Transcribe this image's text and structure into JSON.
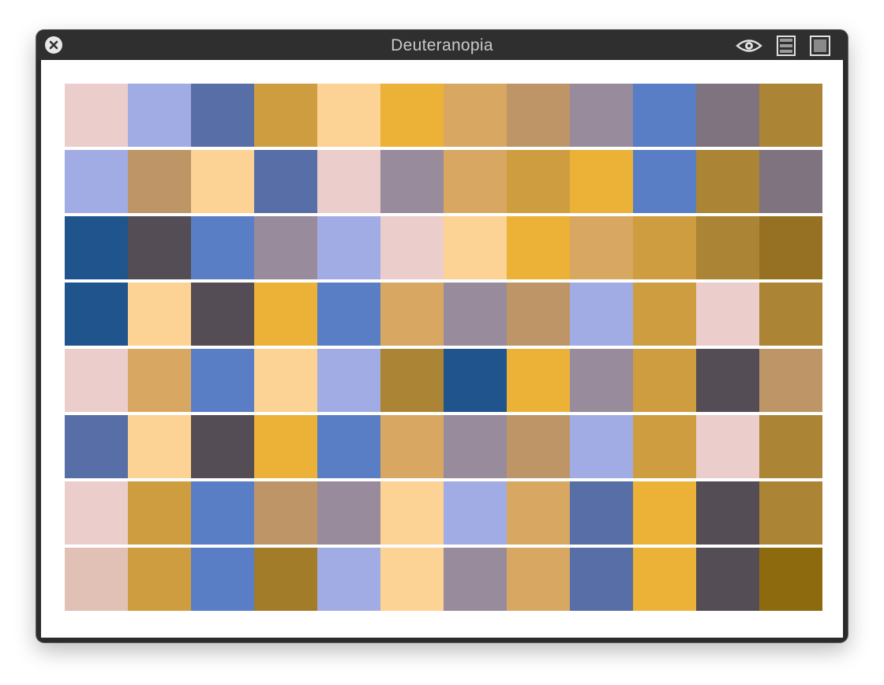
{
  "window": {
    "title": "Deuteranopia",
    "close_icon": "close-icon",
    "toolbar_icons": [
      "eye-icon",
      "list-icon",
      "square-icon"
    ]
  },
  "grid": {
    "rows": [
      [
        "#EBCDCB",
        "#A2ACE4",
        "#586EA6",
        "#CE9D40",
        "#FDD295",
        "#EBB237",
        "#D8A863",
        "#BD9566",
        "#988B9C",
        "#597EC6",
        "#7F737F",
        "#AC8435"
      ],
      [
        "#A2ACE4",
        "#BD9566",
        "#FDD295",
        "#586EA6",
        "#EBCDCB",
        "#988B9C",
        "#D8A863",
        "#CE9D40",
        "#EBB237",
        "#597EC6",
        "#AC8435",
        "#7F737F"
      ],
      [
        "#1F548D",
        "#544D55",
        "#597EC6",
        "#988B9C",
        "#A2ACE4",
        "#EBCDCB",
        "#FDD295",
        "#EBB237",
        "#D8A863",
        "#CE9D40",
        "#AC8435",
        "#977123"
      ],
      [
        "#1F548D",
        "#FDD295",
        "#544D55",
        "#EBB237",
        "#597EC6",
        "#D8A863",
        "#988B9C",
        "#BD9566",
        "#A2ACE4",
        "#CE9D40",
        "#EBCDCB",
        "#AC8435"
      ],
      [
        "#EBCDCB",
        "#D8A863",
        "#597EC6",
        "#FDD295",
        "#A2ACE4",
        "#AC8435",
        "#1F548D",
        "#EBB237",
        "#988B9C",
        "#CE9D40",
        "#544D55",
        "#BD9566"
      ],
      [
        "#586EA6",
        "#FDD295",
        "#544D55",
        "#EBB237",
        "#597EC6",
        "#D8A863",
        "#988B9C",
        "#BD9566",
        "#A2ACE4",
        "#CE9D40",
        "#EBCDCB",
        "#AC8435"
      ],
      [
        "#EBCDCB",
        "#CE9D40",
        "#597EC6",
        "#BD9566",
        "#988B9C",
        "#FDD295",
        "#A2ACE4",
        "#D8A863",
        "#586EA6",
        "#EBB237",
        "#544D55",
        "#AC8435"
      ],
      [
        "#E1C1B5",
        "#CE9D40",
        "#597EC6",
        "#A37C2A",
        "#A2ACE4",
        "#FDD295",
        "#988B9C",
        "#D8A863",
        "#586EA6",
        "#EBB237",
        "#544D55",
        "#8D6A0D"
      ]
    ]
  }
}
